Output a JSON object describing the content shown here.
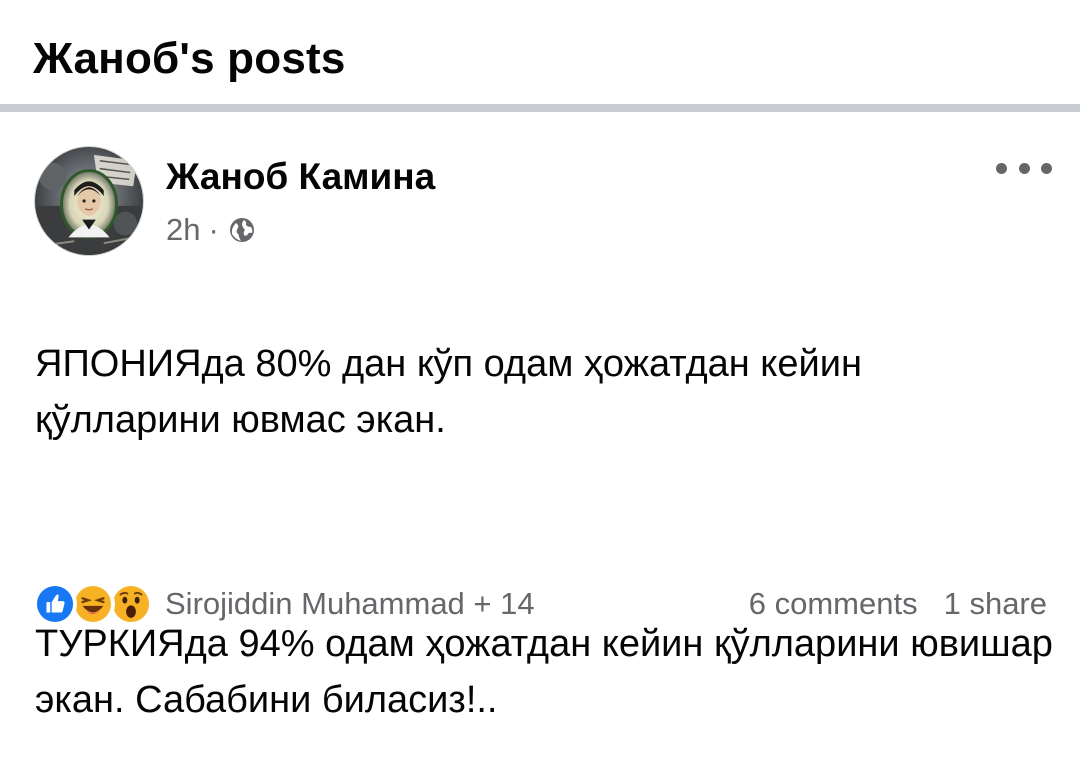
{
  "header": {
    "title": "Жаноб's posts"
  },
  "post": {
    "author": "Жаноб Камина",
    "time": "2h",
    "separator": "·",
    "privacy_icon": "globe-icon",
    "more_icon": "more-options-icon",
    "paragraphs": [
      "ЯПОНИЯда 80% дан кўп одам ҳожатдан кейин қўлларини ювмас экан.",
      "ТУРКИЯда 94% одам ҳожатдан кейин қўлларини ювишар экан. Сабабини биласиз!.."
    ],
    "reactions": {
      "icons": [
        "like-icon",
        "haha-icon",
        "wow-icon"
      ],
      "names": "Sirojiddin Muhammad + 14"
    },
    "comments": "6 comments",
    "shares": "1 share"
  },
  "colors": {
    "text_primary": "#050505",
    "text_secondary": "#65676b",
    "divider": "#c9ccd1",
    "like_blue": "#1877f2",
    "emoji_yellow": "#f7b125"
  }
}
